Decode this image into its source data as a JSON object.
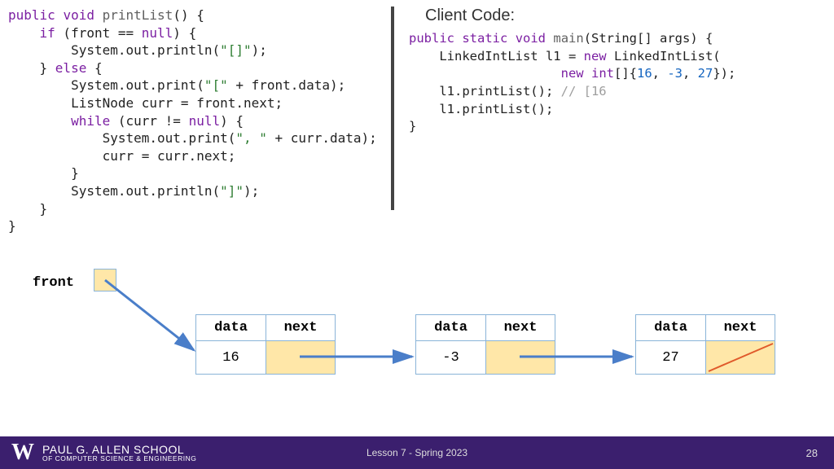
{
  "left_code": {
    "l1_kw1": "public",
    "l1_kw2": "void",
    "l1_method": "printList",
    "l1_rest": "() {",
    "l2_kw": "if",
    "l2_rest1": " (front == ",
    "l2_kw2": "null",
    "l2_rest2": ") {",
    "l3a": "        System.out.println(",
    "l3s": "\"[]\"",
    "l3b": ");",
    "l4a": "    } ",
    "l4kw": "else",
    "l4b": " {",
    "l5a": "        System.out.print(",
    "l5s": "\"[\"",
    "l5b": " + front.data);",
    "l6": "        ListNode curr = front.next;",
    "l7a": "        ",
    "l7kw": "while",
    "l7b": " (curr != ",
    "l7kw2": "null",
    "l7c": ") {",
    "l8a": "            System.out.print(",
    "l8s": "\", \"",
    "l8b": " + curr.data);",
    "l9": "            curr = curr.next;",
    "l10": "        }",
    "l11a": "        System.out.println(",
    "l11s": "\"]\"",
    "l11b": ");",
    "l12": "    }",
    "l13": "}"
  },
  "client_title": "Client Code:",
  "right_code": {
    "r1_kw1": "public",
    "r1_kw2": "static",
    "r1_kw3": "void",
    "r1_m": "main",
    "r1_rest": "(String[] args) {",
    "r2a": "    LinkedIntList l1 = ",
    "r2kw": "new",
    "r2b": " LinkedIntList(",
    "r3a": "                    ",
    "r3kw": "new",
    "r3b": " ",
    "r3kw2": "int",
    "r3c": "[]{",
    "r3n1": "16",
    "r3d": ", ",
    "r3n2": "-3",
    "r3e": ", ",
    "r3n3": "27",
    "r3f": "});",
    "r4a": "    l1.printList(); ",
    "r4c": "// [16",
    "r5": "    l1.printList();",
    "r6": "}"
  },
  "diagram": {
    "front_label": "front",
    "hdr_data": "data",
    "hdr_next": "next",
    "nodes": [
      {
        "value": "16"
      },
      {
        "value": "-3"
      },
      {
        "value": "27"
      }
    ]
  },
  "footer": {
    "logo": "W",
    "school_main": "PAUL G. ALLEN SCHOOL",
    "school_sub": "OF COMPUTER SCIENCE & ENGINEERING",
    "lesson": "Lesson 7 - Spring 2023",
    "page": "28"
  }
}
